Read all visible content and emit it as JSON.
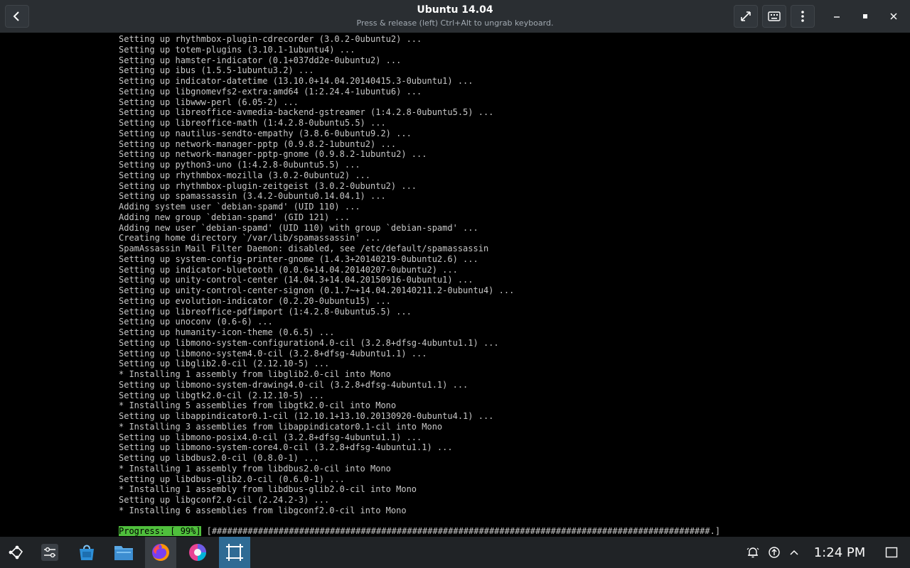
{
  "window": {
    "title": "Ubuntu 14.04",
    "subtitle": "Press & release (left) Ctrl+Alt to ungrab keyboard."
  },
  "titlebar_icons": [
    "back-arrow-icon",
    "fullscreen-icon",
    "keyboard-icon",
    "menu-dots-icon",
    "minimize-icon",
    "maximize-icon",
    "close-icon"
  ],
  "terminal": {
    "lines": [
      "Setting up rhythmbox-plugin-cdrecorder (3.0.2-0ubuntu2) ...",
      "Setting up totem-plugins (3.10.1-1ubuntu4) ...",
      "Setting up hamster-indicator (0.1+037dd2e-0ubuntu2) ...",
      "Setting up ibus (1.5.5-1ubuntu3.2) ...",
      "Setting up indicator-datetime (13.10.0+14.04.20140415.3-0ubuntu1) ...",
      "Setting up libgnomevfs2-extra:amd64 (1:2.24.4-1ubuntu6) ...",
      "Setting up libwww-perl (6.05-2) ...",
      "Setting up libreoffice-avmedia-backend-gstreamer (1:4.2.8-0ubuntu5.5) ...",
      "Setting up libreoffice-math (1:4.2.8-0ubuntu5.5) ...",
      "Setting up nautilus-sendto-empathy (3.8.6-0ubuntu9.2) ...",
      "Setting up network-manager-pptp (0.9.8.2-1ubuntu2) ...",
      "Setting up network-manager-pptp-gnome (0.9.8.2-1ubuntu2) ...",
      "Setting up python3-uno (1:4.2.8-0ubuntu5.5) ...",
      "Setting up rhythmbox-mozilla (3.0.2-0ubuntu2) ...",
      "Setting up rhythmbox-plugin-zeitgeist (3.0.2-0ubuntu2) ...",
      "Setting up spamassassin (3.4.2-0ubuntu0.14.04.1) ...",
      "Adding system user `debian-spamd' (UID 110) ...",
      "Adding new group `debian-spamd' (GID 121) ...",
      "Adding new user `debian-spamd' (UID 110) with group `debian-spamd' ...",
      "Creating home directory `/var/lib/spamassassin' ...",
      "SpamAssassin Mail Filter Daemon: disabled, see /etc/default/spamassassin",
      "Setting up system-config-printer-gnome (1.4.3+20140219-0ubuntu2.6) ...",
      "Setting up indicator-bluetooth (0.0.6+14.04.20140207-0ubuntu2) ...",
      "Setting up unity-control-center (14.04.3+14.04.20150916-0ubuntu1) ...",
      "Setting up unity-control-center-signon (0.1.7~+14.04.20140211.2-0ubuntu4) ...",
      "Setting up evolution-indicator (0.2.20-0ubuntu15) ...",
      "Setting up libreoffice-pdfimport (1:4.2.8-0ubuntu5.5) ...",
      "Setting up unoconv (0.6-6) ...",
      "Setting up humanity-icon-theme (0.6.5) ...",
      "Setting up libmono-system-configuration4.0-cil (3.2.8+dfsg-4ubuntu1.1) ...",
      "Setting up libmono-system4.0-cil (3.2.8+dfsg-4ubuntu1.1) ...",
      "Setting up libglib2.0-cil (2.12.10-5) ...",
      "* Installing 1 assembly from libglib2.0-cil into Mono",
      "Setting up libmono-system-drawing4.0-cil (3.2.8+dfsg-4ubuntu1.1) ...",
      "Setting up libgtk2.0-cil (2.12.10-5) ...",
      "* Installing 5 assemblies from libgtk2.0-cil into Mono",
      "Setting up libappindicator0.1-cil (12.10.1+13.10.20130920-0ubuntu4.1) ...",
      "* Installing 3 assemblies from libappindicator0.1-cil into Mono",
      "Setting up libmono-posix4.0-cil (3.2.8+dfsg-4ubuntu1.1) ...",
      "Setting up libmono-system-core4.0-cil (3.2.8+dfsg-4ubuntu1.1) ...",
      "Setting up libdbus2.0-cil (0.8.0-1) ...",
      "* Installing 1 assembly from libdbus2.0-cil into Mono",
      "Setting up libdbus-glib2.0-cil (0.6.0-1) ...",
      "* Installing 1 assembly from libdbus-glib2.0-cil into Mono",
      "Setting up libgconf2.0-cil (2.24.2-3) ...",
      "* Installing 6 assemblies from libgconf2.0-cil into Mono"
    ],
    "progress_label": "Progress: [ 99%]",
    "progress_bar": "[#################################################################################################.]",
    "progress_percent": 99
  },
  "taskbar": {
    "apps": [
      {
        "name": "app-launcher-icon"
      },
      {
        "name": "system-settings-icon"
      },
      {
        "name": "discover-store-icon"
      },
      {
        "name": "file-manager-icon"
      },
      {
        "name": "firefox-icon"
      },
      {
        "name": "color-app-icon"
      },
      {
        "name": "vm-window-icon"
      }
    ],
    "tray": [
      "notifications-icon",
      "updates-icon",
      "tray-expand-icon"
    ],
    "clock": "1:24 PM"
  },
  "colors": {
    "titlebar_bg": "#2a2e32",
    "taskbar_bg": "#202326",
    "terminal_bg": "#000000",
    "terminal_fg": "#c8c8c8",
    "progress_green": "#4fbf3c",
    "active_app": "#2f6b94"
  }
}
